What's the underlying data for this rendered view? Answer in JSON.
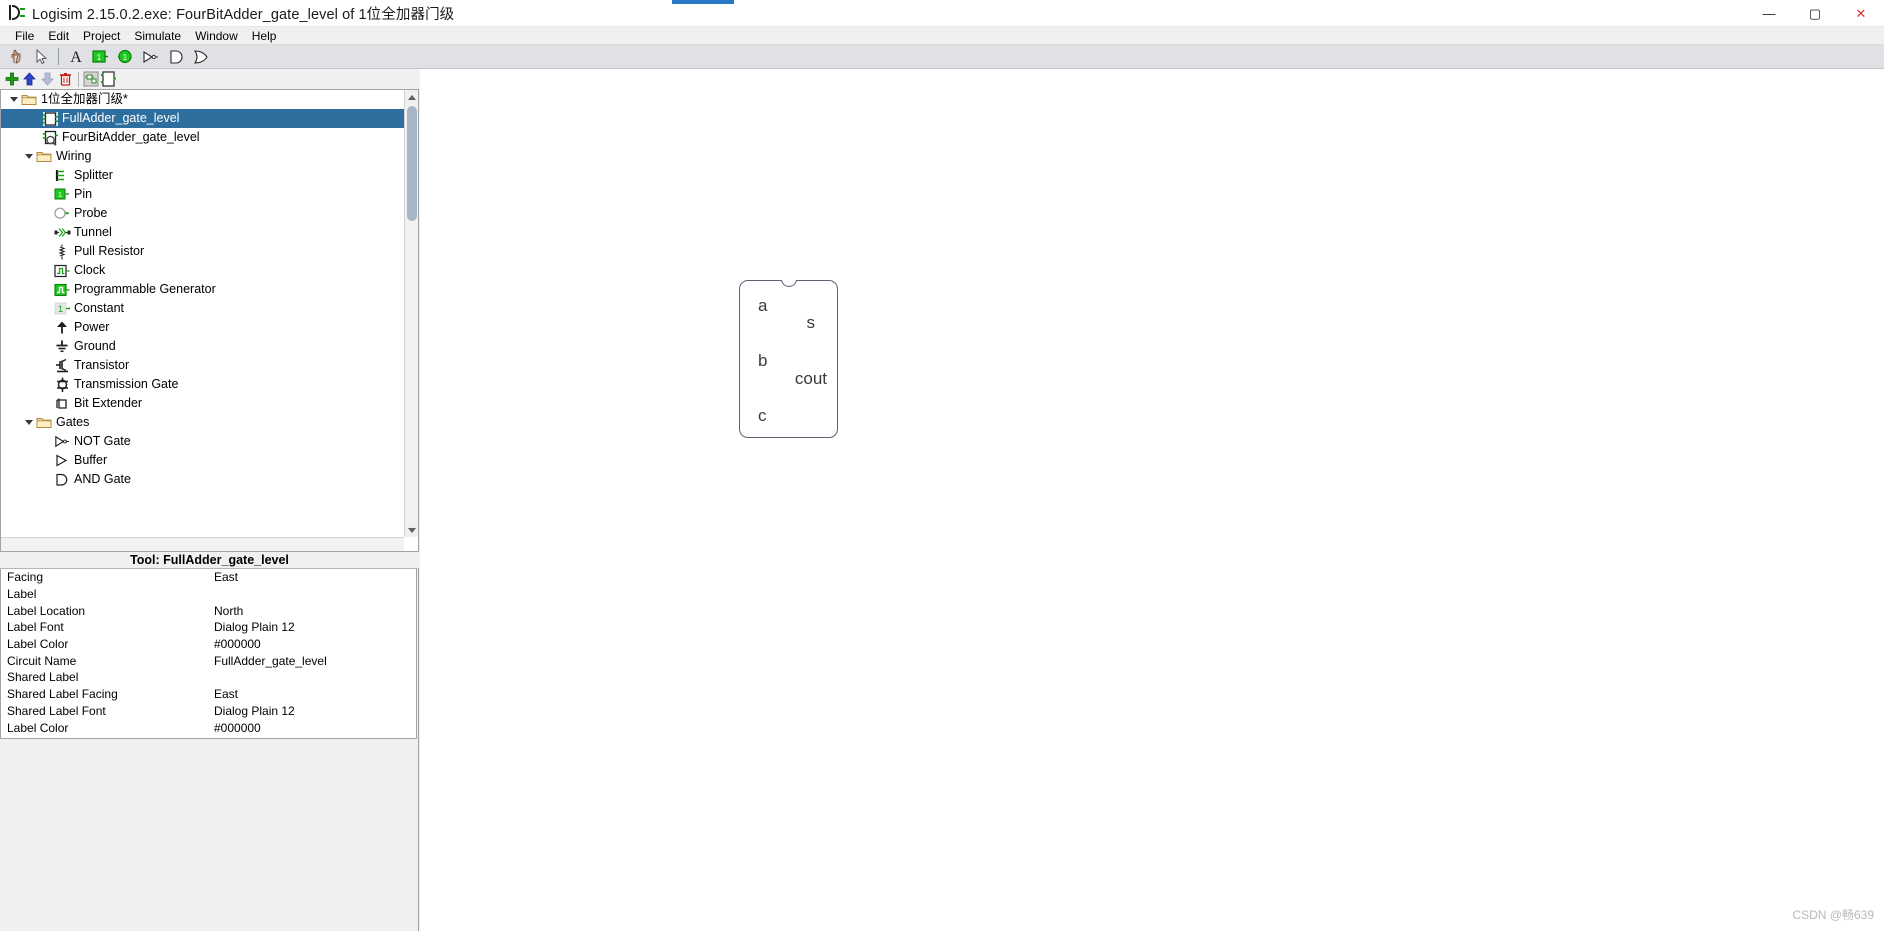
{
  "window": {
    "title": "Logisim 2.15.0.2.exe: FourBitAdder_gate_level of 1位全加器门级",
    "app_icon": "logisim-icon",
    "minimize": "—",
    "maximize": "▢",
    "close": "✕"
  },
  "menubar": {
    "items": [
      "File",
      "Edit",
      "Project",
      "Simulate",
      "Window",
      "Help"
    ]
  },
  "toolbar": {
    "items": [
      {
        "name": "poke-tool-icon",
        "title": "Poke Tool"
      },
      {
        "name": "select-tool-icon",
        "title": "Select Tool"
      },
      {
        "name": "separator",
        "title": ""
      },
      {
        "name": "text-tool-icon",
        "title": "Text Tool"
      },
      {
        "name": "input-pin-icon",
        "title": "Input Pin"
      },
      {
        "name": "output-pin-icon",
        "title": "Output Pin"
      },
      {
        "name": "not-gate-icon",
        "title": "NOT Gate"
      },
      {
        "name": "and-gate-icon",
        "title": "AND Gate"
      },
      {
        "name": "or-gate-icon",
        "title": "OR Gate"
      }
    ]
  },
  "explorer_toolbar": {
    "items": [
      {
        "name": "add-circuit-icon",
        "title": "Add Circuit"
      },
      {
        "name": "move-up-icon",
        "title": "Move Up"
      },
      {
        "name": "move-down-icon",
        "title": "Move Down"
      },
      {
        "name": "delete-icon",
        "title": "Delete"
      },
      {
        "name": "separator",
        "title": ""
      },
      {
        "name": "edit-circuit-appearance-icon",
        "title": "Edit Circuit Appearance"
      },
      {
        "name": "edit-circuit-layout-icon",
        "title": "Edit Circuit Layout"
      }
    ]
  },
  "tree": {
    "root": {
      "label": "1位全加器门级*",
      "icon": "folder-icon",
      "expanded": true
    },
    "nodes": [
      {
        "label": "FullAdder_gate_level",
        "icon": "circuit-icon",
        "indent": 2,
        "selected": true
      },
      {
        "label": "FourBitAdder_gate_level",
        "icon": "circuit-magnifier-icon",
        "indent": 2,
        "selected": false
      },
      {
        "label": "Wiring",
        "icon": "folder-icon",
        "indent": 1,
        "folder": true,
        "expanded": true
      },
      {
        "label": "Splitter",
        "icon": "splitter-icon",
        "indent": 3
      },
      {
        "label": "Pin",
        "icon": "pin-icon",
        "indent": 3
      },
      {
        "label": "Probe",
        "icon": "probe-icon",
        "indent": 3
      },
      {
        "label": "Tunnel",
        "icon": "tunnel-icon",
        "indent": 3
      },
      {
        "label": "Pull Resistor",
        "icon": "pull-resistor-icon",
        "indent": 3
      },
      {
        "label": "Clock",
        "icon": "clock-icon",
        "indent": 3
      },
      {
        "label": "Programmable Generator",
        "icon": "programmable-generator-icon",
        "indent": 3
      },
      {
        "label": "Constant",
        "icon": "constant-icon",
        "indent": 3
      },
      {
        "label": "Power",
        "icon": "power-icon",
        "indent": 3
      },
      {
        "label": "Ground",
        "icon": "ground-icon",
        "indent": 3
      },
      {
        "label": "Transistor",
        "icon": "transistor-icon",
        "indent": 3
      },
      {
        "label": "Transmission Gate",
        "icon": "transmission-gate-icon",
        "indent": 3
      },
      {
        "label": "Bit Extender",
        "icon": "bit-extender-icon",
        "indent": 3
      },
      {
        "label": "Gates",
        "icon": "folder-icon",
        "indent": 1,
        "folder": true,
        "expanded": true
      },
      {
        "label": "NOT Gate",
        "icon": "not-gate-icon",
        "indent": 3
      },
      {
        "label": "Buffer",
        "icon": "buffer-icon",
        "indent": 3
      },
      {
        "label": "AND Gate",
        "icon": "and-gate-icon",
        "indent": 3
      }
    ]
  },
  "attributes": {
    "header": "Tool: FullAdder_gate_level",
    "rows": [
      {
        "key": "Facing",
        "value": "East"
      },
      {
        "key": "Label",
        "value": ""
      },
      {
        "key": "Label Location",
        "value": "North"
      },
      {
        "key": "Label Font",
        "value": "Dialog Plain 12"
      },
      {
        "key": "Label Color",
        "value": "#000000"
      },
      {
        "key": "Circuit Name",
        "value": "FullAdder_gate_level"
      },
      {
        "key": "Shared Label",
        "value": ""
      },
      {
        "key": "Shared Label Facing",
        "value": "East"
      },
      {
        "key": "Shared Label Font",
        "value": "Dialog Plain 12"
      },
      {
        "key": "Label Color",
        "value": "#000000"
      }
    ]
  },
  "canvas": {
    "component": {
      "name": "FullAdder_gate_level",
      "inputs": [
        "a",
        "b",
        "c"
      ],
      "outputs": [
        "s",
        "cout"
      ]
    },
    "watermark": "CSDN @畅639"
  },
  "colors": {
    "selection_blue": "#2e6e9e",
    "accent_tab": "#2878c8",
    "panel_bg": "#f0f0f0",
    "toolbar_bg": "#dfe1e5",
    "green": "#1aa21a"
  }
}
